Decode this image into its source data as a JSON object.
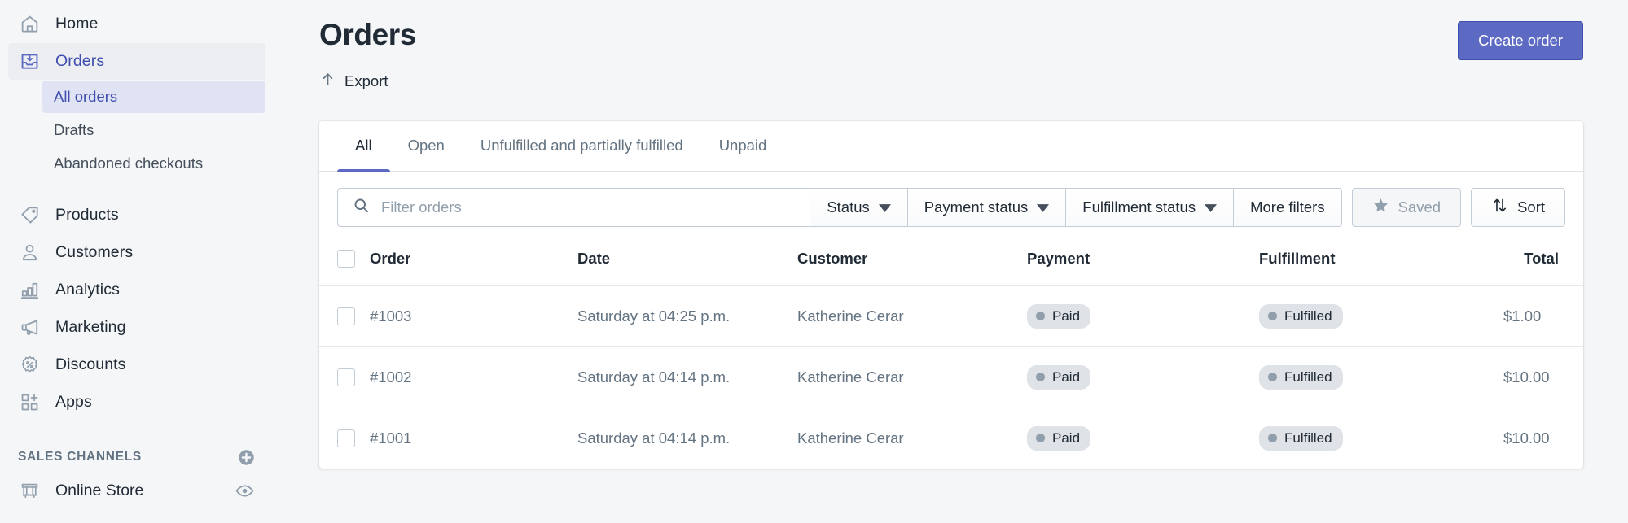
{
  "sidebar": {
    "items": [
      {
        "label": "Home",
        "icon": "home-icon",
        "key": "home"
      },
      {
        "label": "Orders",
        "icon": "orders-inbox-icon",
        "key": "orders"
      },
      {
        "label": "Products",
        "icon": "tag-icon",
        "key": "products"
      },
      {
        "label": "Customers",
        "icon": "person-icon",
        "key": "customers"
      },
      {
        "label": "Analytics",
        "icon": "bar-chart-icon",
        "key": "analytics"
      },
      {
        "label": "Marketing",
        "icon": "megaphone-icon",
        "key": "marketing"
      },
      {
        "label": "Discounts",
        "icon": "discount-percent-icon",
        "key": "discounts"
      },
      {
        "label": "Apps",
        "icon": "apps-grid-plus-icon",
        "key": "apps"
      }
    ],
    "sub_items": [
      {
        "label": "All orders",
        "current": true
      },
      {
        "label": "Drafts",
        "current": false
      },
      {
        "label": "Abandoned checkouts",
        "current": false
      }
    ],
    "sales_channels": {
      "heading": "SALES CHANNELS",
      "add_icon": "plus-circle-icon",
      "channels": [
        {
          "label": "Online Store",
          "icon": "store-icon",
          "action_icon": "eye-icon"
        }
      ]
    }
  },
  "header": {
    "title": "Orders",
    "export_label": "Export",
    "export_icon": "upload-arrow-icon",
    "create_order_label": "Create order"
  },
  "tabs": [
    {
      "label": "All",
      "active": true
    },
    {
      "label": "Open",
      "active": false
    },
    {
      "label": "Unfulfilled and partially fulfilled",
      "active": false
    },
    {
      "label": "Unpaid",
      "active": false
    }
  ],
  "filters": {
    "search_placeholder": "Filter orders",
    "search_value": "",
    "search_icon": "search-icon",
    "status_label": "Status",
    "payment_status_label": "Payment status",
    "fulfillment_status_label": "Fulfillment status",
    "more_filters_label": "More filters",
    "saved_label": "Saved",
    "saved_icon": "star-icon",
    "sort_label": "Sort",
    "sort_icon": "sort-arrows-icon"
  },
  "table": {
    "columns": [
      "Order",
      "Date",
      "Customer",
      "Payment",
      "Fulfillment",
      "Total"
    ],
    "rows": [
      {
        "order": "#1003",
        "date": "Saturday at 04:25 p.m.",
        "customer": "Katherine Cerar",
        "payment": "Paid",
        "fulfillment": "Fulfilled",
        "total": "$1.00"
      },
      {
        "order": "#1002",
        "date": "Saturday at 04:14 p.m.",
        "customer": "Katherine Cerar",
        "payment": "Paid",
        "fulfillment": "Fulfilled",
        "total": "$10.00"
      },
      {
        "order": "#1001",
        "date": "Saturday at 04:14 p.m.",
        "customer": "Katherine Cerar",
        "payment": "Paid",
        "fulfillment": "Fulfilled",
        "total": "$10.00"
      }
    ]
  },
  "colors": {
    "accent": "#5c6ac4",
    "accent_dark": "#3f4eae",
    "text": "#212b36",
    "subdued": "#637381",
    "badge_bg": "#dfe3e8",
    "badge_dot": "#919eab",
    "page_bg": "#f4f6f8",
    "border": "#dfe3e8"
  }
}
